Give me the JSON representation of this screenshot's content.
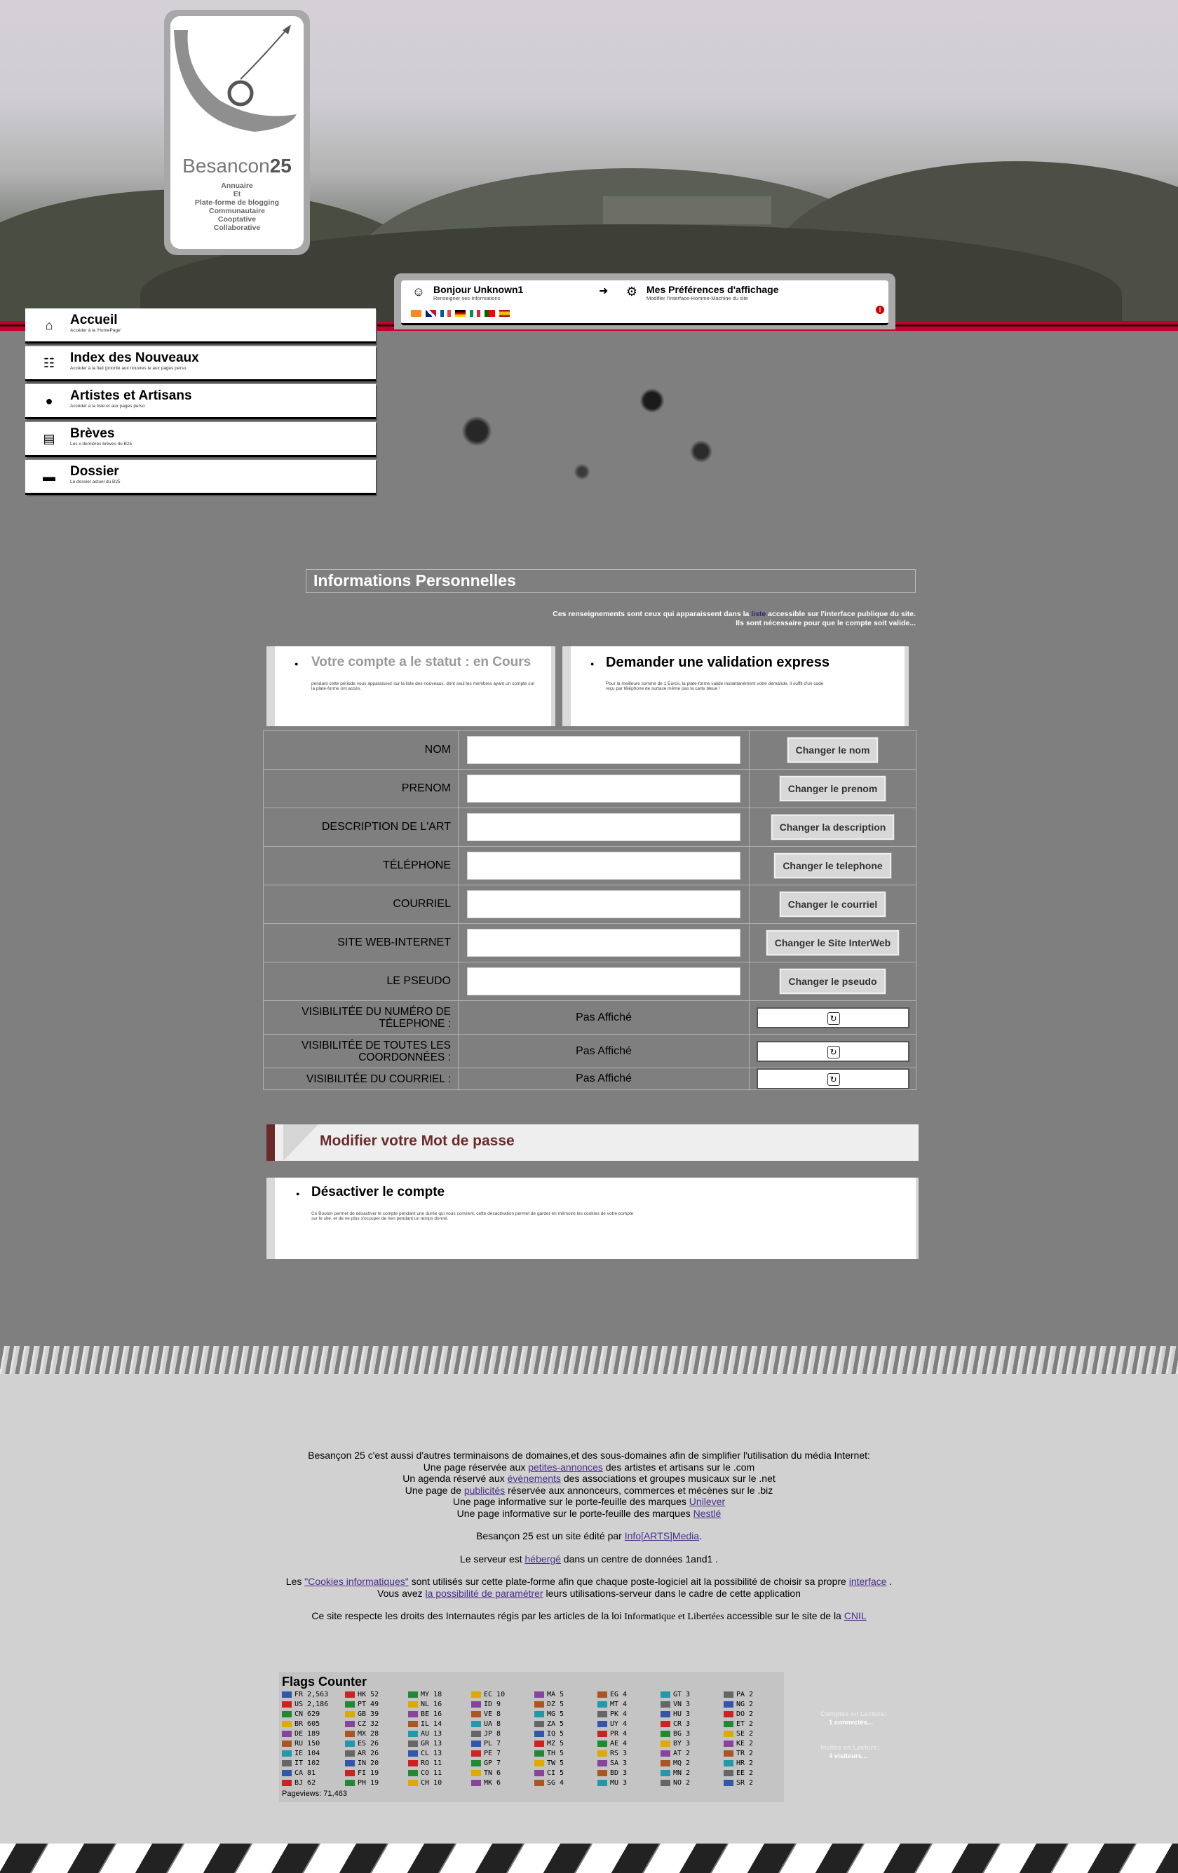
{
  "logo": {
    "brand_light": "Besancon",
    "brand_bold": "25",
    "tagline": [
      "Annuaire",
      "Et",
      "Plate-forme de blogging",
      "Communautaire",
      "Cooptative",
      "Collaborative"
    ]
  },
  "userbar": {
    "greeting": "Bonjour Unknown1",
    "greeting_sub": "Renseigner ses Informations",
    "prefs": "Mes Préférences d'affichage",
    "prefs_sub": "Modifier l'Interface-Homme-Machine du site"
  },
  "nav": [
    {
      "icon": "home-icon",
      "label": "Accueil",
      "sub": "Accéder à la 'HomePage'"
    },
    {
      "icon": "sitemap-icon",
      "label": "Index des Nouveaux",
      "sub": "Accéder à la fiail (priorité aux nouvres le aux pages perso"
    },
    {
      "icon": "user-icon",
      "label": "Artistes et Artisans",
      "sub": "Accéder à la liste et aux pages perso"
    },
    {
      "icon": "document-icon",
      "label": "Brèves",
      "sub": "Les x dernières brèves du B25"
    },
    {
      "icon": "newspaper-icon",
      "label": "Dossier",
      "sub": "Le dossier actuel du B25"
    }
  ],
  "section": {
    "title": "Informations Personnelles",
    "note_pre": "Ces renseignements sont ceux qui apparaissent dans la ",
    "note_link": "liste",
    "note_post": " accessible sur l'interface publique du site.",
    "note_line2": "Ils sont nécessaire pour que le compte soit valide..."
  },
  "status_card": {
    "title": "Votre compte a le statut : en Cours",
    "desc": "pendant cette période vous apparaissez sur la liste des nouveaux, dont seul les membres ayant un compte sur la plate-forme ont accès."
  },
  "express_card": {
    "title": "Demander une validation express",
    "desc": "Pour la meilleure somme de 1 Euros, la plate-forme valide instantanément votre demande, il suffit d'un code reçu par téléphone de surtaxe même pas la carte bleue !"
  },
  "fields": [
    {
      "label": "NOM",
      "button": "Changer le nom"
    },
    {
      "label": "PRENOM",
      "button": "Changer le prenom"
    },
    {
      "label": "DESCRIPTION DE L'ART",
      "button": "Changer la description"
    },
    {
      "label": "TÉLÉPHONE",
      "button": "Changer le telephone"
    },
    {
      "label": "COURRIEL",
      "button": "Changer le courriel"
    },
    {
      "label": "SITE WEB-INTERNET",
      "button": "Changer le Site InterWeb"
    },
    {
      "label": "LE PSEUDO",
      "button": "Changer le pseudo"
    }
  ],
  "visibility": [
    {
      "label": "VISIBILITÉE DU NUMÉRO DE TÉLEPHONE :",
      "value": "Pas Affiché"
    },
    {
      "label": "VISIBILITÉE DE TOUTES LES COORDONNÉES :",
      "value": "Pas Affiché"
    },
    {
      "label": "VISIBILITÉE DU COURRIEL :",
      "value": "Pas Affiché"
    }
  ],
  "password": {
    "title": "Modifier votre Mot de passe"
  },
  "deactivate": {
    "title": "Désactiver le compte",
    "desc": "Ce Bouton permet de désactiver le compte pendant une durée qui vous convient, cette désactivation permet de garder en mémoire les cookies de votre compte sur le site, et de ne plus s'occuper de rien pendant un temps donné."
  },
  "footer": {
    "l1": "Besançon 25 c'est aussi d'autres terminaisons de domaines,et des sous-domaines afin de simplifier l'utilisation du média Internet:",
    "l2a": "Une page réservée aux ",
    "l2link": "petites-annonces",
    "l2b": " des artistes et artisans sur le .com",
    "l3a": "Un agenda réservé aux ",
    "l3link": "évènements",
    "l3b": " des associations et groupes musicaux sur le .net",
    "l4a": "Une page de ",
    "l4link": "publicités",
    "l4b": " réservée aux annonceurs, commerces et mécènes sur le .biz",
    "l5a": "Une page informative sur le porte-feuille des marques ",
    "l5link": "Unilever",
    "l6a": "Une page informative sur le porte-feuille des marques ",
    "l6link": "Nestlé",
    "l7a": "Besançon 25 est un site édité par ",
    "l7link": "Info[ARTS]Media",
    "l7b": ".",
    "l8a": "Le serveur est ",
    "l8link": "hébergé",
    "l8b": " dans un centre de données 1and1 .",
    "l9a": "Les ",
    "l9link": "\"Cookies informatiques\"",
    "l9b": " sont utilisés sur cette plate-forme afin que chaque poste-logiciel ait la possibilité de choisir sa propre ",
    "l9link2": "interface",
    "l9c": " .",
    "l10a": "Vous avez ",
    "l10link": "la possibilité de paramétrer",
    "l10b": " leurs utilisations-serveur dans le cadre de cette application",
    "l11a": "Ce site respecte les droits des Internautes régis par les articles de la loi ",
    "l11em": "Informatique et Libertées",
    "l11b": " accessible sur le site de la ",
    "l11link": "CNIL"
  },
  "flag_counter": {
    "title": "Flags Counter",
    "pageviews": "Pageviews: 71,463",
    "columns": [
      [
        [
          "FR",
          "2,563"
        ],
        [
          "US",
          "2,186"
        ],
        [
          "CN",
          "629"
        ],
        [
          "BR",
          "605"
        ],
        [
          "DE",
          "189"
        ],
        [
          "RU",
          "150"
        ],
        [
          "IE",
          "104"
        ],
        [
          "IT",
          "102"
        ],
        [
          "CA",
          "81"
        ],
        [
          "BJ",
          "62"
        ]
      ],
      [
        [
          "HK",
          "52"
        ],
        [
          "PT",
          "49"
        ],
        [
          "GB",
          "39"
        ],
        [
          "CZ",
          "32"
        ],
        [
          "MX",
          "28"
        ],
        [
          "ES",
          "26"
        ],
        [
          "AR",
          "26"
        ],
        [
          "IN",
          "20"
        ],
        [
          "FI",
          "19"
        ],
        [
          "PH",
          "19"
        ]
      ],
      [
        [
          "MY",
          "18"
        ],
        [
          "NL",
          "16"
        ],
        [
          "BE",
          "16"
        ],
        [
          "IL",
          "14"
        ],
        [
          "AU",
          "13"
        ],
        [
          "GR",
          "13"
        ],
        [
          "CL",
          "13"
        ],
        [
          "RO",
          "11"
        ],
        [
          "CO",
          "11"
        ],
        [
          "CH",
          "10"
        ]
      ],
      [
        [
          "EC",
          "10"
        ],
        [
          "ID",
          "9"
        ],
        [
          "VE",
          "8"
        ],
        [
          "UA",
          "8"
        ],
        [
          "JP",
          "8"
        ],
        [
          "PL",
          "7"
        ],
        [
          "PE",
          "7"
        ],
        [
          "GP",
          "7"
        ],
        [
          "TN",
          "6"
        ],
        [
          "MK",
          "6"
        ]
      ],
      [
        [
          "MA",
          "5"
        ],
        [
          "DZ",
          "5"
        ],
        [
          "MG",
          "5"
        ],
        [
          "ZA",
          "5"
        ],
        [
          "IQ",
          "5"
        ],
        [
          "MZ",
          "5"
        ],
        [
          "TH",
          "5"
        ],
        [
          "TW",
          "5"
        ],
        [
          "CI",
          "5"
        ],
        [
          "SG",
          "4"
        ]
      ],
      [
        [
          "EG",
          "4"
        ],
        [
          "MT",
          "4"
        ],
        [
          "PK",
          "4"
        ],
        [
          "UY",
          "4"
        ],
        [
          "PR",
          "4"
        ],
        [
          "AE",
          "4"
        ],
        [
          "RS",
          "3"
        ],
        [
          "SA",
          "3"
        ],
        [
          "BD",
          "3"
        ],
        [
          "MU",
          "3"
        ]
      ],
      [
        [
          "GT",
          "3"
        ],
        [
          "VN",
          "3"
        ],
        [
          "HU",
          "3"
        ],
        [
          "CR",
          "3"
        ],
        [
          "BG",
          "3"
        ],
        [
          "BY",
          "3"
        ],
        [
          "AT",
          "2"
        ],
        [
          "MQ",
          "2"
        ],
        [
          "MN",
          "2"
        ],
        [
          "NO",
          "2"
        ]
      ],
      [
        [
          "PA",
          "2"
        ],
        [
          "NG",
          "2"
        ],
        [
          "DO",
          "2"
        ],
        [
          "ET",
          "2"
        ],
        [
          "SE",
          "2"
        ],
        [
          "KE",
          "2"
        ],
        [
          "TR",
          "2"
        ],
        [
          "HR",
          "2"
        ],
        [
          "EE",
          "2"
        ],
        [
          "SR",
          "2"
        ]
      ]
    ]
  },
  "stats": {
    "reading_label": "Comptes en Lecture:",
    "reading_value": "1 connectés...",
    "guests_label": "Invités en Lecture:",
    "guests_value": "4 visiteurs..."
  }
}
